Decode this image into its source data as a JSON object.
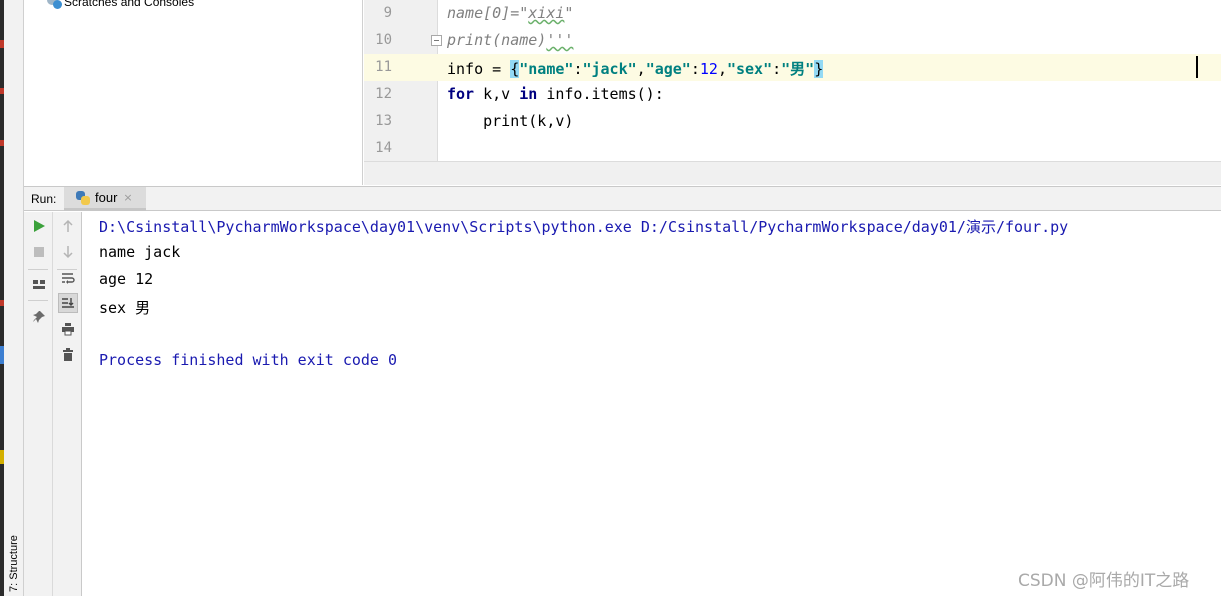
{
  "project_tree": {
    "scratches_label": "Scratches and Consoles"
  },
  "editor": {
    "lines": [
      {
        "num": "9",
        "text": "name[0]=\"xixi\""
      },
      {
        "num": "10",
        "text": "print(name)'''"
      },
      {
        "num": "11",
        "text": "info = {\"name\":\"jack\",\"age\":12,\"sex\":\"男\"}"
      },
      {
        "num": "12",
        "text": "for k,v in info.items():"
      },
      {
        "num": "13",
        "text": "    print(k,v)"
      },
      {
        "num": "14",
        "text": ""
      }
    ]
  },
  "run_panel": {
    "label": "Run:",
    "tab_label": "four",
    "tab_close": "×"
  },
  "side_tab": {
    "structure_label": "7: Structure"
  },
  "console": {
    "lines": [
      "D:\\Csinstall\\PycharmWorkspace\\day01\\venv\\Scripts\\python.exe D:/Csinstall/PycharmWorkspace/day01/演示/four.py",
      "name jack",
      "age 12",
      "sex 男",
      "",
      "Process finished with exit code 0"
    ]
  },
  "watermark": "CSDN @阿伟的IT之路",
  "colors": {
    "keyword": "#000080",
    "string": "#008080",
    "number": "#0000ff",
    "comment": "#808080",
    "current_line": "#fdfbe3",
    "console_system": "#1a1ab0",
    "run_icon": "#3ba13b"
  },
  "icons": {
    "run": "play-icon",
    "stop": "stop-icon",
    "layout": "layout-icon",
    "pin": "pin-icon",
    "up": "arrow-up-icon",
    "down": "arrow-down-icon",
    "wrap": "soft-wrap-icon",
    "scroll": "scroll-to-end-icon",
    "print": "print-icon",
    "trash": "trash-icon"
  }
}
